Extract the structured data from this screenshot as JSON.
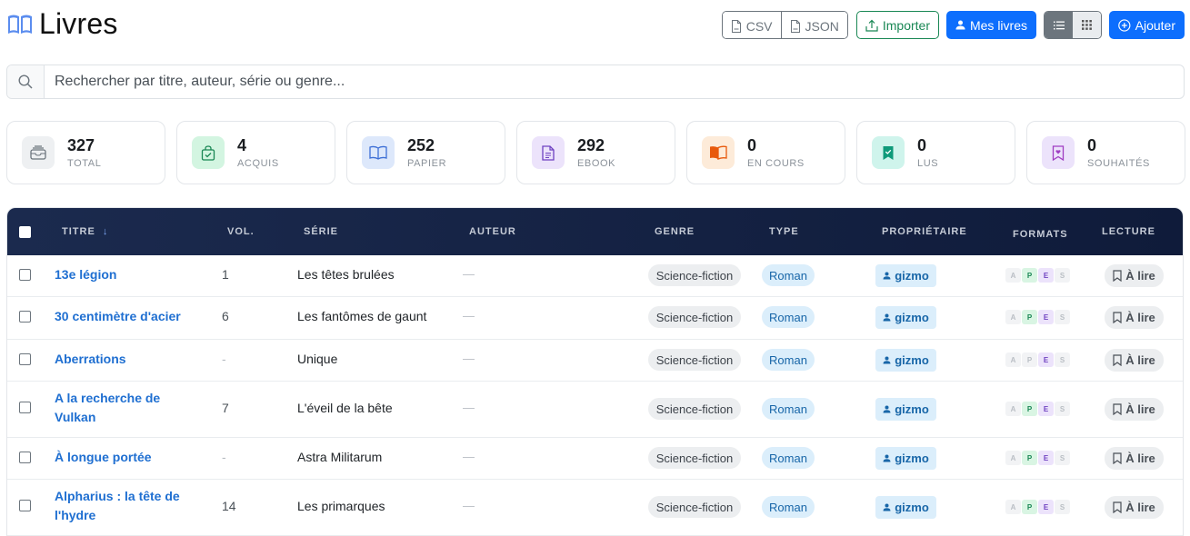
{
  "header": {
    "title": "Livres",
    "export_csv": "CSV",
    "export_json": "JSON",
    "import": "Importer",
    "my_books": "Mes livres",
    "add": "Ajouter"
  },
  "search": {
    "placeholder": "Rechercher par titre, auteur, série ou genre...",
    "value": ""
  },
  "stats": [
    {
      "value": "327",
      "label": "TOTAL",
      "icon": "archive-icon"
    },
    {
      "value": "4",
      "label": "ACQUIS",
      "icon": "bag-check-icon"
    },
    {
      "value": "252",
      "label": "PAPIER",
      "icon": "book-open-icon"
    },
    {
      "value": "292",
      "label": "EBOOK",
      "icon": "file-text-icon"
    },
    {
      "value": "0",
      "label": "EN COURS",
      "icon": "book-reading-icon"
    },
    {
      "value": "0",
      "label": "LUS",
      "icon": "bookmark-check-icon"
    },
    {
      "value": "0",
      "label": "SOUHAITÉS",
      "icon": "bookmark-heart-icon"
    }
  ],
  "table": {
    "columns": {
      "titre": "TITRE",
      "vol": "VOL.",
      "serie": "SÉRIE",
      "auteur": "AUTEUR",
      "genre": "GENRE",
      "type": "TYPE",
      "proprietaire": "PROPRIÉTAIRE",
      "formats": "FORMATS",
      "lecture": "LECTURE"
    },
    "sort_indicator": "↓",
    "format_letters": [
      "A",
      "P",
      "E",
      "S"
    ],
    "rows": [
      {
        "titre": "13e légion",
        "vol": "1",
        "serie": "Les têtes brulées",
        "auteur": "—",
        "genre": "Science-fiction",
        "type": "Roman",
        "proprietaire": "gizmo",
        "lecture": "À lire"
      },
      {
        "titre": "30 centimètre d'acier",
        "vol": "6",
        "serie": "Les fantômes de gaunt",
        "auteur": "—",
        "genre": "Science-fiction",
        "type": "Roman",
        "proprietaire": "gizmo",
        "lecture": "À lire"
      },
      {
        "titre": "Aberrations",
        "vol": "-",
        "serie": "Unique",
        "auteur": "—",
        "genre": "Science-fiction",
        "type": "Roman",
        "proprietaire": "gizmo",
        "lecture": "À lire"
      },
      {
        "titre": "A la recherche de Vulkan",
        "vol": "7",
        "serie": "L'éveil de la bête",
        "auteur": "—",
        "genre": "Science-fiction",
        "type": "Roman",
        "proprietaire": "gizmo",
        "lecture": "À lire"
      },
      {
        "titre": "À longue portée",
        "vol": "-",
        "serie": "Astra Militarum",
        "auteur": "—",
        "genre": "Science-fiction",
        "type": "Roman",
        "proprietaire": "gizmo",
        "lecture": "À lire"
      },
      {
        "titre": "Alpharius : la tête de l'hydre",
        "vol": "14",
        "serie": "Les primarques",
        "auteur": "—",
        "genre": "Science-fiction",
        "type": "Roman",
        "proprietaire": "gizmo",
        "lecture": "À lire"
      }
    ]
  }
}
